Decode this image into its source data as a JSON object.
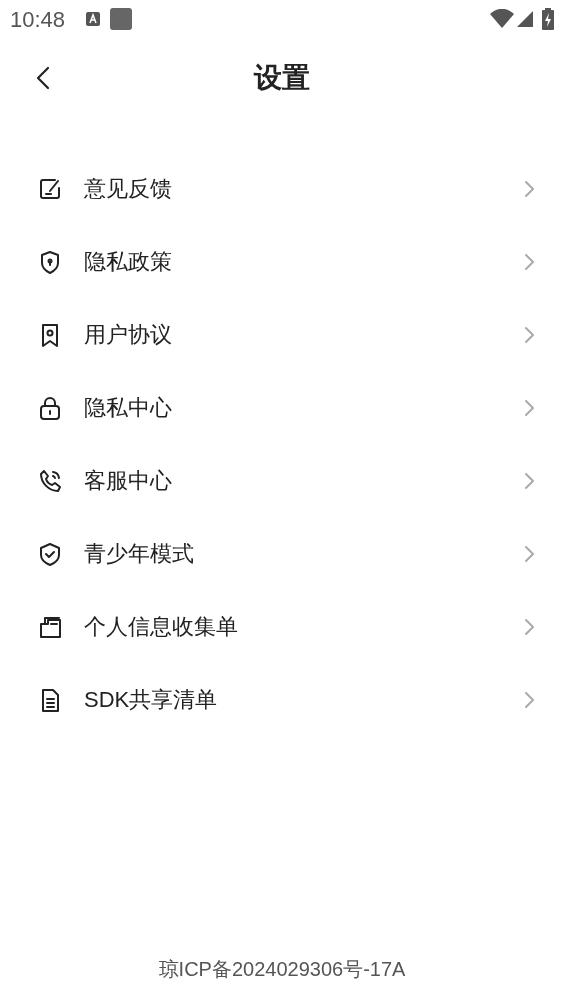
{
  "status_bar": {
    "time": "10:48"
  },
  "header": {
    "title": "设置"
  },
  "menu": [
    {
      "label": "意见反馈"
    },
    {
      "label": "隐私政策"
    },
    {
      "label": "用户协议"
    },
    {
      "label": "隐私中心"
    },
    {
      "label": "客服中心"
    },
    {
      "label": "青少年模式"
    },
    {
      "label": "个人信息收集单"
    },
    {
      "label": "SDK共享清单"
    }
  ],
  "footer": {
    "text": "琼ICP备2024029306号-17A"
  }
}
